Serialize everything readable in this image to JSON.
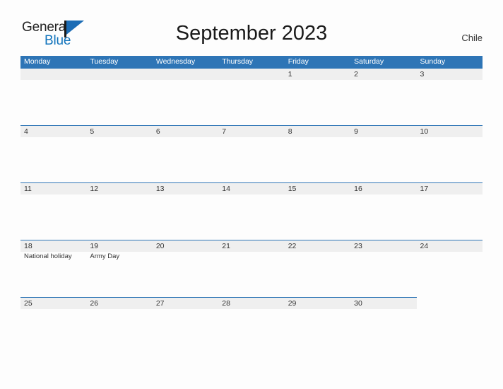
{
  "brand": {
    "word_one": "General",
    "word_two": "Blue",
    "flag_icon": "blue-flag-triangle-icon",
    "accent_color": "#1274bc"
  },
  "header": {
    "title": "September 2023",
    "region": "Chile"
  },
  "calendar": {
    "header_color": "#2e75b6",
    "band_color": "#efefef",
    "weekdays": [
      "Monday",
      "Tuesday",
      "Wednesday",
      "Thursday",
      "Friday",
      "Saturday",
      "Sunday"
    ],
    "weeks": [
      {
        "band_full_width": true,
        "days": [
          {
            "num": "",
            "event": ""
          },
          {
            "num": "",
            "event": ""
          },
          {
            "num": "",
            "event": ""
          },
          {
            "num": "",
            "event": ""
          },
          {
            "num": "1",
            "event": ""
          },
          {
            "num": "2",
            "event": ""
          },
          {
            "num": "3",
            "event": ""
          }
        ]
      },
      {
        "band_full_width": true,
        "days": [
          {
            "num": "4",
            "event": ""
          },
          {
            "num": "5",
            "event": ""
          },
          {
            "num": "6",
            "event": ""
          },
          {
            "num": "7",
            "event": ""
          },
          {
            "num": "8",
            "event": ""
          },
          {
            "num": "9",
            "event": ""
          },
          {
            "num": "10",
            "event": ""
          }
        ]
      },
      {
        "band_full_width": true,
        "days": [
          {
            "num": "11",
            "event": ""
          },
          {
            "num": "12",
            "event": ""
          },
          {
            "num": "13",
            "event": ""
          },
          {
            "num": "14",
            "event": ""
          },
          {
            "num": "15",
            "event": ""
          },
          {
            "num": "16",
            "event": ""
          },
          {
            "num": "17",
            "event": ""
          }
        ]
      },
      {
        "band_full_width": true,
        "days": [
          {
            "num": "18",
            "event": "National holiday"
          },
          {
            "num": "19",
            "event": "Army Day"
          },
          {
            "num": "20",
            "event": ""
          },
          {
            "num": "21",
            "event": ""
          },
          {
            "num": "22",
            "event": ""
          },
          {
            "num": "23",
            "event": ""
          },
          {
            "num": "24",
            "event": ""
          }
        ]
      },
      {
        "band_full_width": false,
        "days": [
          {
            "num": "25",
            "event": ""
          },
          {
            "num": "26",
            "event": ""
          },
          {
            "num": "27",
            "event": ""
          },
          {
            "num": "28",
            "event": ""
          },
          {
            "num": "29",
            "event": ""
          },
          {
            "num": "30",
            "event": ""
          },
          {
            "num": "",
            "event": ""
          }
        ]
      }
    ]
  }
}
